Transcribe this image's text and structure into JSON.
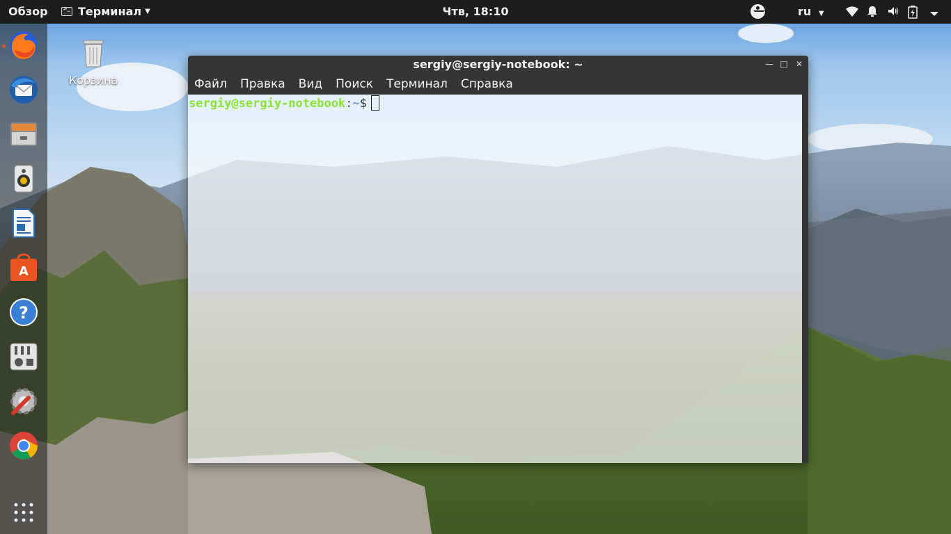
{
  "topbar": {
    "activities": "Обзор",
    "app_name": "Терминал",
    "clock": "Чтв, 18:10",
    "language": "ru"
  },
  "dock": {
    "items": [
      {
        "icon": "firefox-icon",
        "running": true
      },
      {
        "icon": "thunderbird-icon",
        "running": false
      },
      {
        "icon": "files-icon",
        "running": false
      },
      {
        "icon": "rhythmbox-icon",
        "running": false
      },
      {
        "icon": "libreoffice-writer-icon",
        "running": false
      },
      {
        "icon": "software-center-icon",
        "running": false
      },
      {
        "icon": "help-icon",
        "running": false
      },
      {
        "icon": "settings-icon",
        "running": false
      },
      {
        "icon": "system-tools-icon",
        "running": false
      },
      {
        "icon": "chrome-icon",
        "running": false
      },
      {
        "icon": "show-applications-icon",
        "running": false
      }
    ]
  },
  "desktop": {
    "trash_label": "Корзина"
  },
  "terminal": {
    "title": "sergiy@sergiy-notebook: ~",
    "menu": [
      "Файл",
      "Правка",
      "Вид",
      "Поиск",
      "Терминал",
      "Справка"
    ],
    "prompt_user": "sergiy@sergiy-notebook",
    "prompt_sep": ":",
    "prompt_path": "~",
    "prompt_symbol": "$"
  },
  "colors": {
    "prompt_user": "#8ae234",
    "prompt_path": "#729fcf",
    "topbar_bg": "#1d1d1d",
    "ubuntu_accent": "#e95420"
  }
}
